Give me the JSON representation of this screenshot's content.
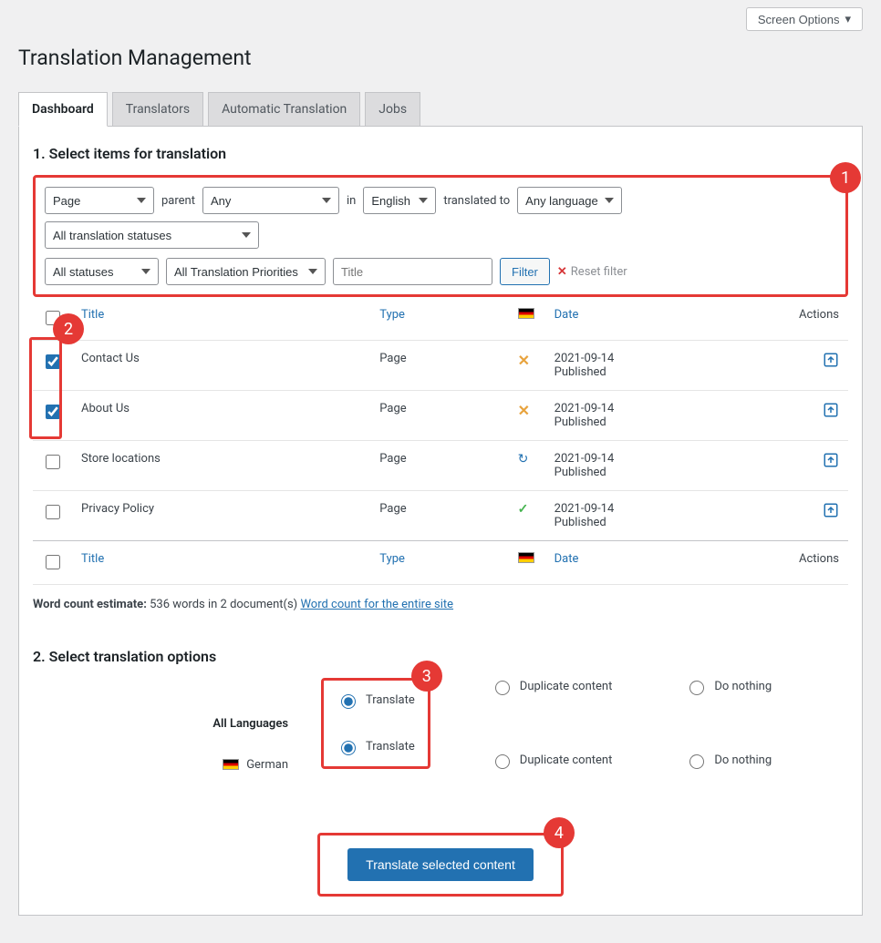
{
  "screen_options_label": "Screen Options",
  "page_title": "Translation Management",
  "tabs": [
    "Dashboard",
    "Translators",
    "Automatic Translation",
    "Jobs"
  ],
  "active_tab": 0,
  "step1": {
    "heading": "1. Select items for translation",
    "filters": {
      "post_type": "Page",
      "parent_label": "parent",
      "parent_value": "Any",
      "in_label": "in",
      "language": "English",
      "translated_to_label": "translated to",
      "target_language": "Any language",
      "translation_status": "All translation statuses",
      "status": "All statuses",
      "priority": "All Translation Priorities",
      "title_placeholder": "Title",
      "filter_btn": "Filter",
      "reset_btn": "Reset filter"
    },
    "table": {
      "columns": {
        "title": "Title",
        "type": "Type",
        "date": "Date",
        "actions": "Actions"
      },
      "rows": [
        {
          "title": "Contact Us",
          "type": "Page",
          "status": "not-translated",
          "date": "2021-09-14",
          "state": "Published",
          "checked": true
        },
        {
          "title": "About Us",
          "type": "Page",
          "status": "not-translated",
          "date": "2021-09-14",
          "state": "Published",
          "checked": true
        },
        {
          "title": "Store locations",
          "type": "Page",
          "status": "update",
          "date": "2021-09-14",
          "state": "Published",
          "checked": false
        },
        {
          "title": "Privacy Policy",
          "type": "Page",
          "status": "complete",
          "date": "2021-09-14",
          "state": "Published",
          "checked": false
        }
      ]
    },
    "word_count_prefix": "Word count estimate:",
    "word_count_text": "536 words in 2 document(s)",
    "word_count_link": "Word count for the entire site"
  },
  "step2": {
    "heading": "2. Select translation options",
    "all_languages_label": "All Languages",
    "language_rows": [
      {
        "label": "German",
        "flag": "de"
      }
    ],
    "options": {
      "translate": "Translate",
      "duplicate": "Duplicate content",
      "nothing": "Do nothing"
    },
    "submit_label": "Translate selected content"
  },
  "markers": {
    "m1": "1",
    "m2": "2",
    "m3": "3",
    "m4": "4"
  }
}
